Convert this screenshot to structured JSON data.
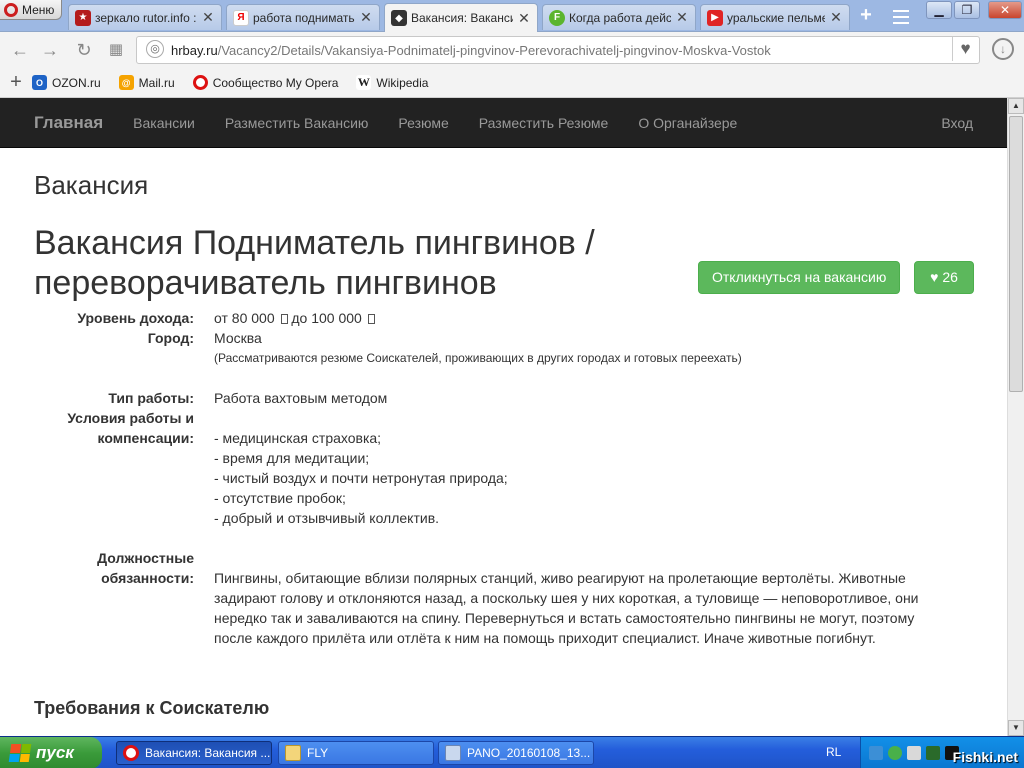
{
  "browser": {
    "menu_label": "Меню",
    "tabs": [
      {
        "label": "зеркало rutor.info :: ",
        "icon": "rutor-icon",
        "active": false
      },
      {
        "label": "работа поднимать п",
        "icon": "yandex-icon",
        "active": false
      },
      {
        "label": "Вакансия: Вакансия",
        "icon": "hrbay-icon",
        "active": true
      },
      {
        "label": "Когда работа дейст",
        "icon": "feed-icon",
        "active": false
      },
      {
        "label": "уральские пельмени",
        "icon": "youtube-icon",
        "active": false
      }
    ],
    "new_tab_label": "+",
    "url_host": "hrbay.ru",
    "url_path": "/Vacancy2/Details/Vakansiya-Podnimatelj-pingvinov-Perevorachivatelj-pingvinov-Moskva-Vostok",
    "bookmarks": [
      {
        "label": "OZON.ru",
        "icon": "ozon-icon"
      },
      {
        "label": "Mail.ru",
        "icon": "mailru-icon"
      },
      {
        "label": "Сообщество My Opera",
        "icon": "opera-icon"
      },
      {
        "label": "Wikipedia",
        "icon": "wikipedia-icon"
      }
    ]
  },
  "site": {
    "brand": "Главная",
    "nav": [
      "Вакансии",
      "Разместить Вакансию",
      "Резюме",
      "Разместить Резюме",
      "О Органайзере"
    ],
    "login": "Вход"
  },
  "page": {
    "section_title": "Вакансия",
    "job_title": "Вакансия Подниматель пингвинов / переворачиватель пингвинов",
    "apply_label": "Откликнуться на вакансию",
    "likes": "26",
    "fields": {
      "income_label": "Уровень дохода:",
      "income_value": "от 80 000",
      "income_to": "до 100 000",
      "city_label": "Город:",
      "city_value": "Москва",
      "city_note": "(Рассматриваются резюме Соискателей, проживающих в других городах и готовых переехать)",
      "work_type_label": "Тип работы:",
      "work_type_value": "Работа вахтовым методом",
      "conditions_label_1": "Условия работы и",
      "conditions_label_2": "компенсации:",
      "conditions": [
        "- медицинская страховка;",
        "- время для медитации;",
        "- чистый воздух и почти нетронутая природа;",
        "- отсутствие пробок;",
        "- добрый и отзывчивый коллектив."
      ],
      "duties_label_1": "Должностные",
      "duties_label_2": "обязанности:",
      "duties_text": "Пингвины, обитающие вблизи полярных станций, живо реагируют на пролетающие вертолёты. Животные задирают голову и отклоняются назад, а поскольку шея у них короткая, а туловище — неповоротливое, они нередко так и заваливаются на спину. Перевернуться и встать самостоятельно пингвины не могут, поэтому после каждого прилёта или отлёта к ним на помощь приходит специалист. Иначе животные погибнут."
    },
    "requirements_title": "Требования к Соискателю"
  },
  "taskbar": {
    "start_label": "пуск",
    "tasks": [
      {
        "label": "Вакансия: Вакансия ...",
        "active": true
      },
      {
        "label": "FLY",
        "active": false
      },
      {
        "label": "PANO_20160108_13...",
        "active": false
      }
    ],
    "lang": "RL",
    "watermark": "Fishki.net"
  },
  "colors": {
    "navbar_bg": "#222222",
    "success_button": "#5cb85c",
    "taskbar_blue": "#245edb",
    "start_green": "#3a9b3a"
  }
}
